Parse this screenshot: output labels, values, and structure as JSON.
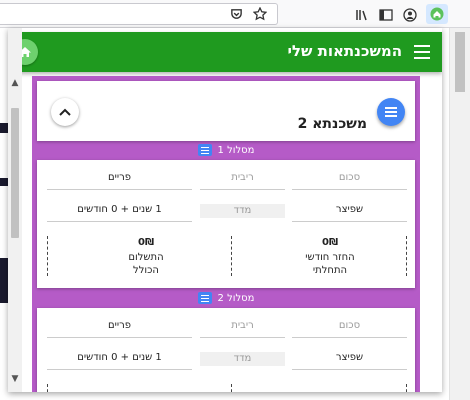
{
  "colors": {
    "app_bar": "#1f9a1f",
    "accent_purple": "#b55bc7",
    "fab_blue": "#4285f4"
  },
  "browser": {
    "icons": [
      "pocket-icon",
      "bookmark-star-icon",
      "library-icon",
      "sidebar-icon",
      "account-icon",
      "extension-home-icon"
    ]
  },
  "app": {
    "title": "המשכנתאות שלי"
  },
  "mortgage": {
    "title": "משכנתא 2"
  },
  "tracks": [
    {
      "label": "מסלול 1",
      "amount_placeholder": "סכום",
      "interest_placeholder": "ריבית",
      "payments_label": "פריים",
      "method": "שפיצר",
      "index_label": "מדד",
      "duration": "1 שנים + 0 חודשים",
      "monthly_amount": "0₪",
      "monthly_label_1": "החזר חודשי",
      "monthly_label_2": "התחלתי",
      "total_amount": "0₪",
      "total_label_1": "התשלום",
      "total_label_2": "הכולל"
    },
    {
      "label": "מסלול 2",
      "amount_placeholder": "סכום",
      "interest_placeholder": "ריבית",
      "payments_label": "פריים",
      "method": "שפיצר",
      "index_label": "מדד",
      "duration": "1 שנים + 0 חודשים"
    }
  ]
}
